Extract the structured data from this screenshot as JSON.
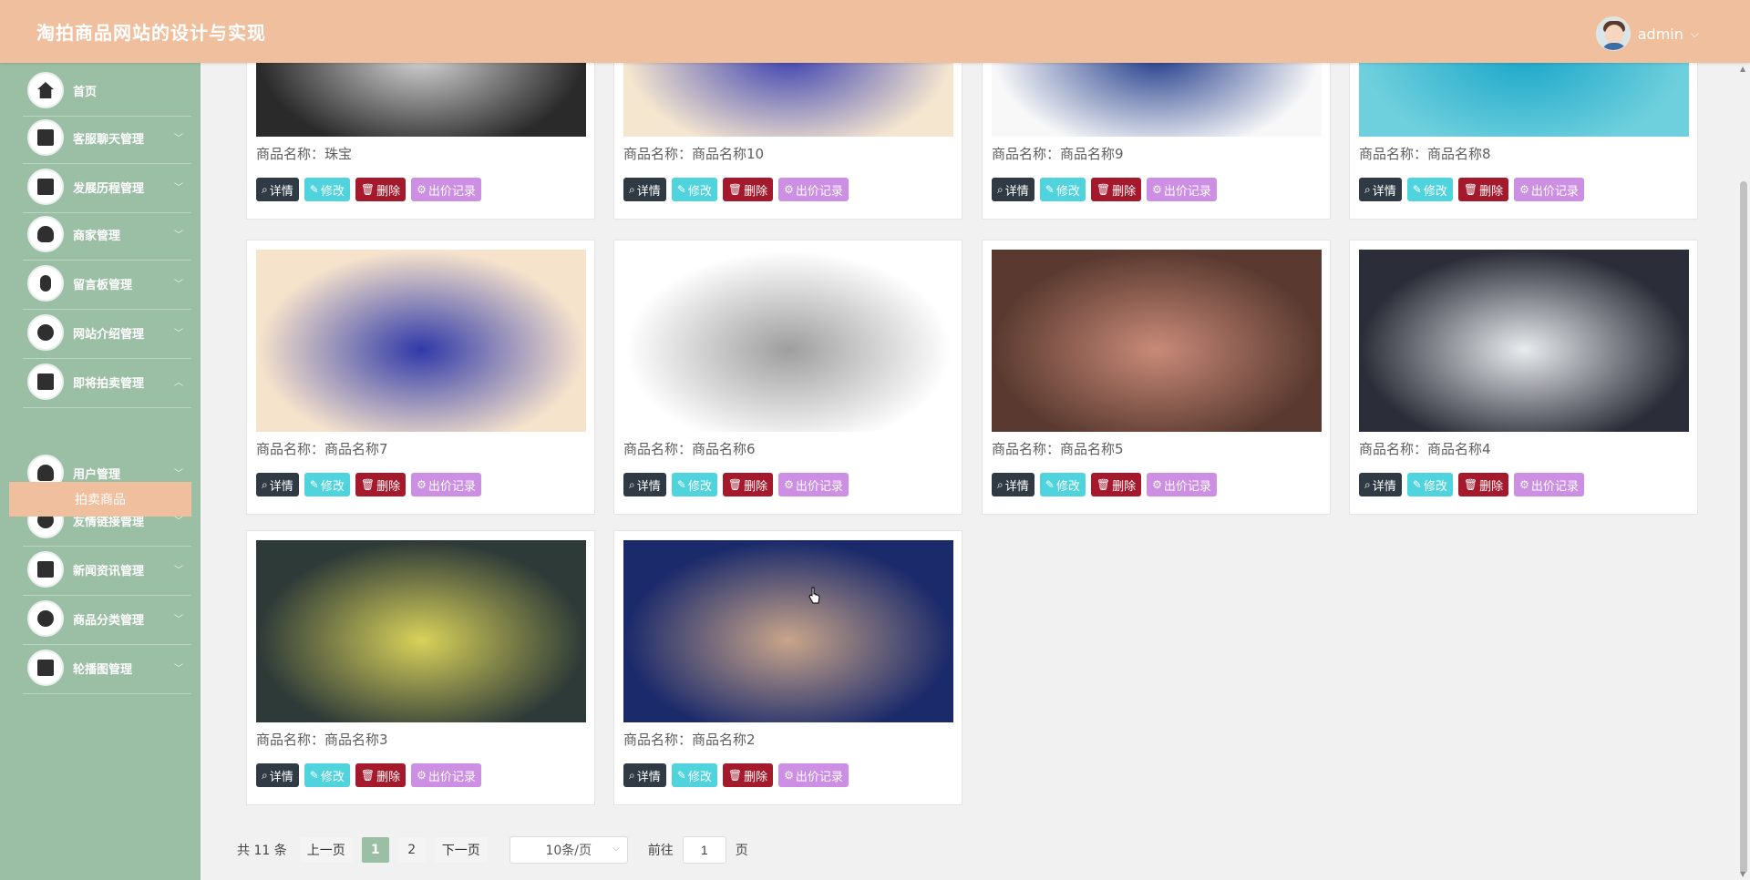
{
  "app": {
    "title": "淘拍商品网站的设计与实现"
  },
  "user": {
    "name": "admin",
    "avatar_icon": "user-avatar"
  },
  "sidebar": {
    "items": [
      {
        "label": "首页",
        "icon": "home-icon",
        "has_arrow": false
      },
      {
        "label": "客服聊天管理",
        "icon": "chat-icon",
        "has_arrow": true
      },
      {
        "label": "发展历程管理",
        "icon": "archive-icon",
        "has_arrow": true
      },
      {
        "label": "商家管理",
        "icon": "merchant-icon",
        "has_arrow": true
      },
      {
        "label": "留言板管理",
        "icon": "mouse-icon",
        "has_arrow": true
      },
      {
        "label": "网站介绍管理",
        "icon": "disc-icon",
        "has_arrow": true
      },
      {
        "label": "即将拍卖管理",
        "icon": "briefcase-icon",
        "has_arrow": true,
        "expanded": true
      },
      {
        "label": "用户管理",
        "icon": "user-icon",
        "has_arrow": true
      },
      {
        "label": "友情链接管理",
        "icon": "drop-icon",
        "has_arrow": true
      },
      {
        "label": "新闻资讯管理",
        "icon": "news-icon",
        "has_arrow": true
      },
      {
        "label": "商品分类管理",
        "icon": "category-icon",
        "has_arrow": true
      },
      {
        "label": "轮播图管理",
        "icon": "carousel-icon",
        "has_arrow": true
      }
    ],
    "active_sub_item": "拍卖商品"
  },
  "buttons": {
    "detail": "详情",
    "edit": "修改",
    "delete": "删除",
    "bid_records": "出价记录"
  },
  "products": [
    {
      "name": "商品名称：珠宝",
      "palette": [
        "#2a2a2a",
        "#d8d8d8"
      ]
    },
    {
      "name": "商品名称：商品名称10",
      "palette": [
        "#f4e6cf",
        "#3a3fb0"
      ]
    },
    {
      "name": "商品名称：商品名称9",
      "palette": [
        "#f8f8f8",
        "#1f3a8a"
      ]
    },
    {
      "name": "商品名称：商品名称8",
      "palette": [
        "#6fd0dd",
        "#1aa6c9"
      ]
    },
    {
      "name": "商品名称：商品名称7",
      "palette": [
        "#f6e3cc",
        "#3039a8"
      ]
    },
    {
      "name": "商品名称：商品名称6",
      "palette": [
        "#ffffff",
        "#9e9e9e"
      ]
    },
    {
      "name": "商品名称：商品名称5",
      "palette": [
        "#5a3a30",
        "#c98a78"
      ]
    },
    {
      "name": "商品名称：商品名称4",
      "palette": [
        "#2b2e38",
        "#e9ecef"
      ]
    },
    {
      "name": "商品名称：商品名称3",
      "palette": [
        "#2e3a38",
        "#d9d25a"
      ]
    },
    {
      "name": "商品名称：商品名称2",
      "palette": [
        "#1b2a6b",
        "#c9a58a"
      ]
    }
  ],
  "pagination": {
    "total": "共 11 条",
    "prev": "上一页",
    "pages": [
      "1",
      "2"
    ],
    "current": "1",
    "next": "下一页",
    "page_size": "10条/页",
    "goto_label": "前往",
    "goto_value": "1",
    "page_suffix": "页"
  },
  "colors": {
    "header": "#f0bf9e",
    "sidebar": "#9bbfa4",
    "detail_btn": "#2f3a44",
    "edit_btn": "#4fd3dd",
    "delete_btn": "#a4192c",
    "bid_btn": "#cc8fe3"
  }
}
